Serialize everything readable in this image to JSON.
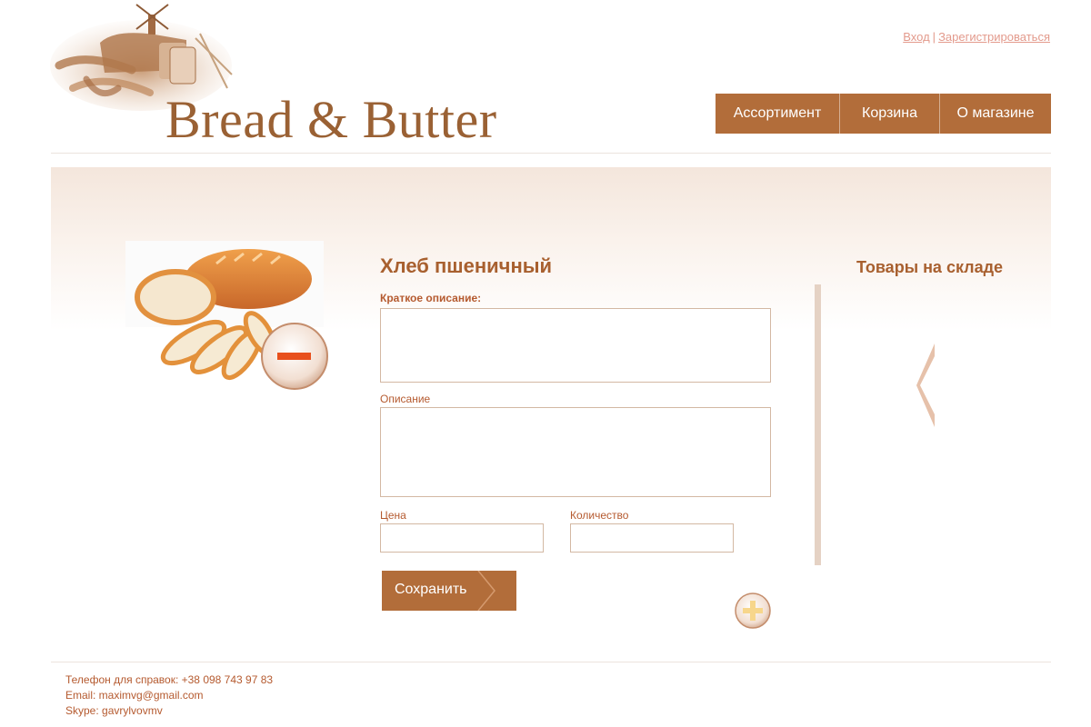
{
  "brand": {
    "name": "Bread & Butter"
  },
  "auth": {
    "login": "Вход",
    "separator": "|",
    "register": "Зарегистрироваться"
  },
  "nav": {
    "items": [
      {
        "label": "Ассортимент"
      },
      {
        "label": "Корзина"
      },
      {
        "label": "О магазине"
      }
    ]
  },
  "product": {
    "title": "Хлеб пшеничный",
    "short_desc_label": "Краткое описание:",
    "short_desc_value": "",
    "desc_label": "Описание",
    "desc_value": "",
    "price_label": "Цена",
    "price_value": "",
    "qty_label": "Количество",
    "qty_value": "",
    "save_label": "Сохранить"
  },
  "sidebar": {
    "title": "Товары на складе"
  },
  "footer": {
    "phone": "Телефон для справок: +38 098 743 97 83",
    "email": "Email: maximvg@gmail.com",
    "skype": "Skype: gavrylvovmv"
  },
  "colors": {
    "accent": "#b26d3a",
    "text": "#a0522d",
    "link": "#e39a8c",
    "remove": "#e8501d"
  }
}
